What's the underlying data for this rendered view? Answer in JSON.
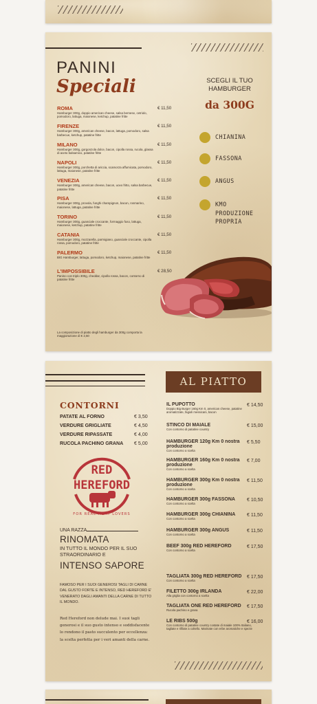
{
  "page1": {
    "title_top": "PANINI",
    "title_bottom": "Speciali",
    "items": [
      {
        "name": "ROMA",
        "desc": "Hamburger 300g, doppio american cheese, salsa bernese, cetriolo, pomodoro, lattuga, maionese, ketchup, patatine fritte",
        "price": "€ 11,50"
      },
      {
        "name": "FIRENZE",
        "desc": "Hamburger 300g, american cheese, bacon, lattuga, pomodoro, salsa barbecue, ketchup, patatine fritte",
        "price": "€ 11,50"
      },
      {
        "name": "MILANO",
        "desc": "Hamburger 300g, gorgonzola dolce, bacon, cipolla rossa, rucola, glassa di aceto balsamico, patatine fritte",
        "price": "€ 11,50"
      },
      {
        "name": "NAPOLI",
        "desc": "Hamburger 300g, porchetta di ariccia, scamorza affumicata, pomodoro, lattuga, maionese, patatine fritte",
        "price": "€ 11,50"
      },
      {
        "name": "VENEZIA",
        "desc": "Hamburger 300g, american cheese, bacon, uovo fritto, salsa barbecue, patatine fritte",
        "price": "€ 11,50"
      },
      {
        "name": "PISA",
        "desc": "Hamburger 300g, provola, funghi champignon, bacon, rosmarino, maionese, lattuga, patatine fritte",
        "price": "€ 11,50"
      },
      {
        "name": "TORINO",
        "desc": "Hamburger 300g, guanciale croccante, formaggio fuso, lattuga, maionese, ketchup, patatine fritte",
        "price": "€ 11,50"
      },
      {
        "name": "CATANIA",
        "desc": "Hamburger 300g, mozzarella, parmigiano, guanciale croccante, cipolla rossa, pomodoro, patatine fritte",
        "price": "€ 11,50"
      },
      {
        "name": "PALERMO",
        "desc": "BIG Hamburger, lattuga, pomodoro, ketchup, maionese, patatine fritte",
        "price": "€ 11,50"
      },
      {
        "name": "L'IMPOSSIBILE",
        "desc": "Panino con triplo 300g, cheddar, cipolla rossa, bacon, contorno di patatine fritte",
        "price": "€ 28,50"
      }
    ],
    "choose_text": "SCEGLI IL TUO HAMBURGER",
    "weight": "da 300G",
    "breeds": [
      "CHIANINA",
      "FASSONA",
      "ANGUS",
      "KMO PRODUZIONE PROPRIA"
    ],
    "footnote": "La composizione di piatto degli hamburger da 300g comporta la maggiorazione di € 2,50"
  },
  "page2": {
    "band_title": "AL PIATTO",
    "contorni_title": "CONTORNI",
    "contorni": [
      {
        "name": "PATATE AL FORNO",
        "price": "€ 3,50"
      },
      {
        "name": "VERDURE GRIGLIATE",
        "price": "€ 4,50"
      },
      {
        "name": "VERDURE RIPASSATE",
        "price": "€ 4,00"
      },
      {
        "name": "RUCOLA PACHINO GRANA",
        "price": "€ 5,00"
      }
    ],
    "logo": {
      "line1": "RED",
      "line2": "HEREFORD",
      "tagline": "FOR REAL MEAT LOVERS"
    },
    "una_razza": "UNA RAZZA",
    "rinomata": "RINOMATA",
    "tutto": "IN TUTTO IL MONDO PER IL SUO STRAORDINARIO E",
    "intenso": "INTENSO SAPORE",
    "famosi": "FAMOSO PER I SUOI GENEROSI TAGLI DI CARNE DAL GUSTO FORTE E INTENSO, RED HEREFORD E' VENERATO DAGLI AMANTI DELLA CARNE DI TUTTO IL MONDO.",
    "serif_para": "Red Hereford non delude mai. I suoi tagli generosi e il suo gusto intenso e soddisfacente lo rendono il pasto succulento per eccellenza: la scelta perfetta per i veri amanti della carne.",
    "dishes": [
      {
        "name": "IL PUPOTTO",
        "desc": "Doppio Big Burger 160g Km 0, american cheese, patatine aromatizzate, fagioli messicani, bacon",
        "price": "€ 14,50"
      },
      {
        "name": "STINCO DI MAIALE",
        "desc": "Con contorno di patatine country",
        "price": "€ 15,00"
      },
      {
        "name": "HAMBURGER 120g Km 0 nostra produzione",
        "desc": "Con contorno a scelta",
        "price": "€ 5,50"
      },
      {
        "name": "HAMBURGER 160g Km 0 nostra produzione",
        "desc": "Con contorno a scelta",
        "price": "€ 7,00"
      },
      {
        "name": "HAMBURGER 300g Km 0 nostra produzione",
        "desc": "Con contorno a scelta",
        "price": "€ 11,50"
      },
      {
        "name": "HAMBURGER 300g FASSONA",
        "desc": "Con contorno a scelta",
        "price": "€ 10,50"
      },
      {
        "name": "HAMBURGER 300g CHIANINA",
        "desc": "Con contorno a scelta",
        "price": "€ 11,50"
      },
      {
        "name": "HAMBURGER 300g ANGUS",
        "desc": "Con contorno a scelta",
        "price": "€ 11,50"
      },
      {
        "name": "BEEF 300g RED HEREFORD",
        "desc": "Con contorno a scelta",
        "price": "€ 17,50"
      },
      {
        "name": "TAGLIATA 300g RED HEREFORD",
        "desc": "Con contorno a scelta",
        "price": "€ 17,50"
      },
      {
        "name": "FILETTO 300g IRLANDA",
        "desc": "Alla griglia con contorno a scelta",
        "price": "€ 22,00"
      },
      {
        "name": "TAGLIATA ONE RED HEREFORD",
        "desc": "Rucola pachino e grana",
        "price": "€ 17,50"
      },
      {
        "name": "LE RIBS 500g",
        "desc": "Con contorno di patatine country costate di maiale 100% Italiano, tagliate e rifilate a coltello. Marinate con erbe aromatiche e spezie",
        "price": "€ 16,00"
      }
    ]
  },
  "colors": {
    "accent_red": "#b03a19",
    "brown_band": "#6b3d24",
    "gold_dot": "#c4a52e",
    "paper": "#e9dbbc"
  }
}
